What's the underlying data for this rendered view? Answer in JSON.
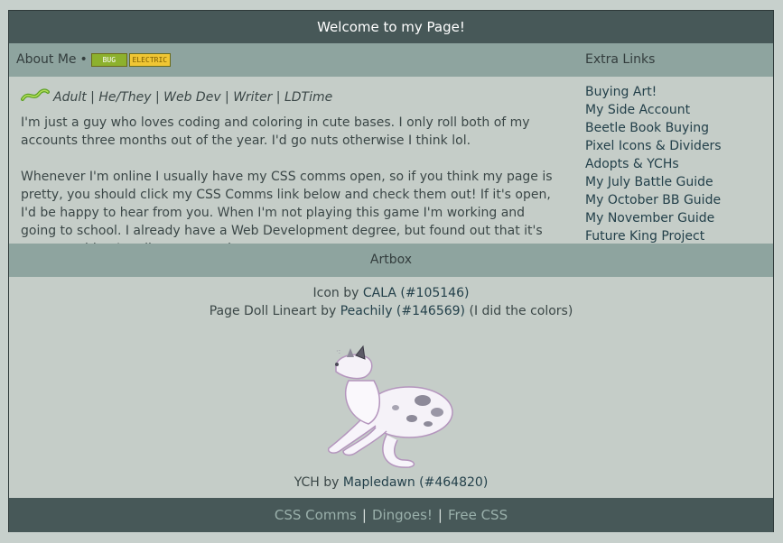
{
  "header": {
    "title": "Welcome to my Page!"
  },
  "about": {
    "heading": "About Me",
    "bullet": "•",
    "types": [
      "BUG",
      "ELECTRIC"
    ],
    "tagline": "Adult | He/They | Web Dev | Writer | LDTime",
    "paragraphs": [
      "I'm just a guy who loves coding and coloring in cute bases. I only roll both of my accounts three months out of the year. I'd go nuts otherwise I think lol.",
      "Whenever I'm online I usually have my CSS comms open, so if you think my page is pretty, you should click my CSS Comms link below and check them out! If it's open, I'd be happy to hear from you. When I'm not playing this game I'm working and going to school. I already have a Web Development degree, but found out that it's not something I really want to take"
    ]
  },
  "extra_links": {
    "heading": "Extra Links",
    "items": [
      "Buying Art!",
      "My Side Account",
      "Beetle Book Buying",
      "Pixel Icons & Dividers",
      "Adopts & YCHs",
      "My July Battle Guide",
      "My October BB Guide",
      "My November Guide",
      "Future King Project"
    ]
  },
  "artbox": {
    "heading": "Artbox",
    "icon_prefix": "Icon by",
    "icon_artist": "CALA (#105146)",
    "doll_prefix": "Page Doll Lineart by",
    "doll_artist": "Peachily (#146569)",
    "doll_suffix": "(I did the colors)",
    "ych_prefix": "YCH by",
    "ych_artist": "Mapledawn (#464820)"
  },
  "footer": {
    "links": [
      "CSS Comms",
      "Dingoes!",
      "Free CSS"
    ],
    "separator": "|"
  },
  "colors": {
    "background": "#c7d0cc",
    "header": "#475858",
    "section_bar": "#8ea49f",
    "link": "#23404a",
    "footer_link": "#9ab0ab",
    "bug_badge": "#8db12e",
    "electric_badge": "#f0c634"
  }
}
